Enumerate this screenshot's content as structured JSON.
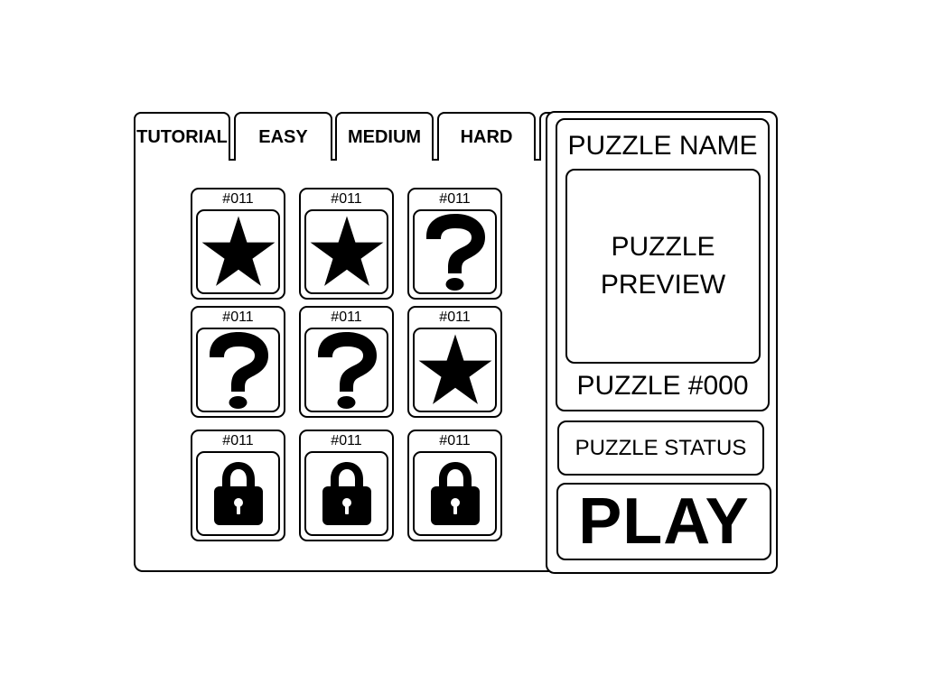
{
  "tabs": [
    {
      "label": "TUTORIAL"
    },
    {
      "label": "EASY"
    },
    {
      "label": "MEDIUM"
    },
    {
      "label": "HARD"
    },
    {
      "label": ""
    }
  ],
  "puzzles": [
    {
      "number": "#011",
      "icon": "star-icon"
    },
    {
      "number": "#011",
      "icon": "star-icon"
    },
    {
      "number": "#011",
      "icon": "question-mark-icon"
    },
    {
      "number": "#011",
      "icon": "question-mark-icon"
    },
    {
      "number": "#011",
      "icon": "question-mark-icon"
    },
    {
      "number": "#011",
      "icon": "star-icon"
    },
    {
      "number": "#011",
      "icon": "lock-icon"
    },
    {
      "number": "#011",
      "icon": "lock-icon"
    },
    {
      "number": "#011",
      "icon": "lock-icon"
    }
  ],
  "details": {
    "name": "PUZZLE NAME",
    "preview_line1": "PUZZLE",
    "preview_line2": "PREVIEW",
    "number": "PUZZLE #000",
    "status": "PUZZLE STATUS",
    "play_label": "PLAY"
  },
  "colors": {
    "ink": "#000000",
    "background": "#ffffff"
  }
}
